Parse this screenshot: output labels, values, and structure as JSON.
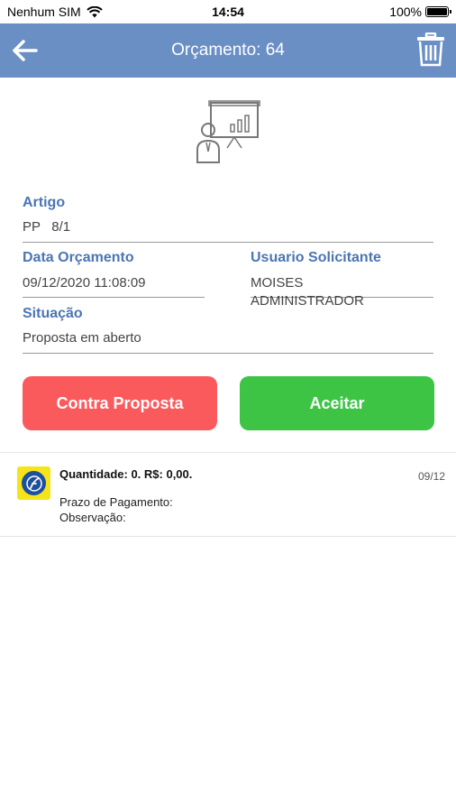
{
  "status_bar": {
    "carrier": "Nenhum SIM",
    "time": "14:54",
    "battery": "100%"
  },
  "header": {
    "title": "Orçamento: 64",
    "back_icon": "arrow-left-icon",
    "delete_icon": "trash-icon",
    "color": "#6a8fc5"
  },
  "illustration": {
    "icon": "presentation-person-icon"
  },
  "form": {
    "artigo": {
      "label": "Artigo",
      "value": "PP   8/1"
    },
    "data_orcamento": {
      "label": "Data Orçamento",
      "value": "09/12/2020 11:08:09"
    },
    "usuario": {
      "label": "Usuario Solicitante",
      "value_line1": "MOISES",
      "value_line2": "ADMINISTRADOR"
    },
    "situacao": {
      "label": "Situação",
      "value": "Proposta em aberto"
    }
  },
  "buttons": {
    "counter": {
      "label": "Contra Proposta",
      "color": "#fb5a5c"
    },
    "accept": {
      "label": "Aceitar",
      "color": "#3dc445"
    }
  },
  "proposals": [
    {
      "title": "Quantidade: 0. R$: 0,00.",
      "date": "09/12",
      "prazo": "Prazo de Pagamento:",
      "observacao": "Observação:"
    }
  ]
}
